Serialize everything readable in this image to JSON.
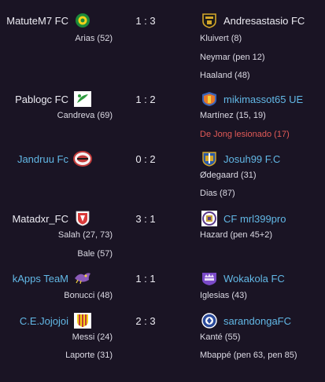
{
  "matches": [
    {
      "home": {
        "name": "MatuteM7 FC",
        "style": "plain",
        "crest": "green-yellow-ring-crest"
      },
      "score": "1 : 3",
      "away": {
        "name": "Andresastasio FC",
        "style": "plain",
        "crest": "gold-black-shield-crest"
      },
      "home_scorers": [
        "Arias (52)"
      ],
      "away_scorers": [
        "Kluivert (8)",
        "Neymar (pen 12)",
        "Haaland (48)"
      ]
    },
    {
      "home": {
        "name": "Pablogc FC",
        "style": "plain",
        "crest": "green-leaf-crest"
      },
      "score": "1 : 2",
      "away": {
        "name": "mikimassot65 UE",
        "style": "link",
        "crest": "orange-shield-crest"
      },
      "home_scorers": [
        "Candreva (69)"
      ],
      "away_scorers": [
        "Martínez (15, 19)"
      ],
      "away_injury": "De Jong lesionado (17)"
    },
    {
      "home": {
        "name": "Jandruu Fc",
        "style": "link",
        "crest": "red-oval-crest"
      },
      "score": "0 : 2",
      "away": {
        "name": "Josuh99 F.C",
        "style": "link",
        "crest": "blue-gold-shield-crest"
      },
      "home_scorers": [],
      "away_scorers": [
        "Ødegaard (31)",
        "Dias (87)"
      ]
    },
    {
      "home": {
        "name": "Matadxr_FC",
        "style": "plain",
        "crest": "red-white-shield-crest"
      },
      "score": "3 : 1",
      "away": {
        "name": "CF mrl399pro",
        "style": "link",
        "crest": "purple-round-crest"
      },
      "home_scorers": [
        "Salah (27, 73)",
        "Bale (57)"
      ],
      "away_scorers": [
        "Hazard (pen 45+2)"
      ]
    },
    {
      "home": {
        "name": "kApps TeaM",
        "style": "link",
        "crest": "bird-crest"
      },
      "score": "1 : 1",
      "away": {
        "name": "Wokakola FC",
        "style": "link",
        "crest": "purple-crown-crest"
      },
      "home_scorers": [
        "Bonucci (48)"
      ],
      "away_scorers": [
        "Iglesias (43)"
      ]
    },
    {
      "home": {
        "name": "C.E.Jojojoi",
        "style": "link",
        "crest": "striped-shield-crest"
      },
      "score": "2 : 3",
      "away": {
        "name": "sarandongaFC",
        "style": "link",
        "crest": "blue-round-crest"
      },
      "home_scorers": [
        "Messi (24)",
        "Laporte (31)"
      ],
      "away_scorers": [
        "Kanté (55)",
        "Mbappé (pen 63, pen 85)"
      ]
    }
  ]
}
